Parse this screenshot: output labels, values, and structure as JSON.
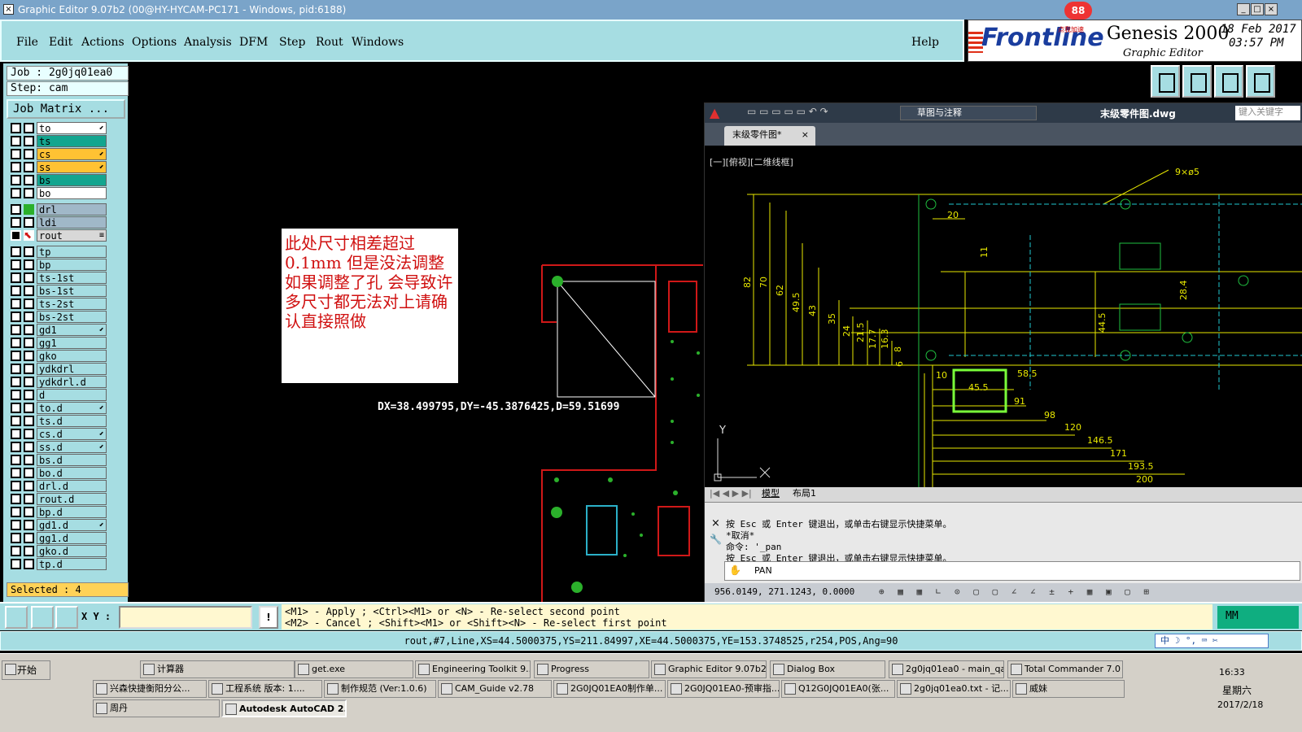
{
  "window": {
    "title": "Graphic Editor 9.07b2 (00@HY-HYCAM-PC171 - Windows, pid:6188)"
  },
  "menu": [
    "File",
    "Edit",
    "Actions",
    "Options",
    "Analysis",
    "DFM",
    "Step",
    "Rout",
    "Windows"
  ],
  "help_label": "Help",
  "brand": {
    "logo": "Frontline",
    "product": "Genesis 2000",
    "subtitle": "Graphic Editor",
    "date": "18 Feb 2017",
    "time": "03:57 PM",
    "badge": "88",
    "badge_sub": "点我加速"
  },
  "job": {
    "job_line": "Job : 2g0jq01ea0",
    "step_line": "Step: cam",
    "matrix_label": "Job Matrix ..."
  },
  "layers": [
    {
      "name": "to",
      "color": "#ffffff",
      "mark": "⬋"
    },
    {
      "name": "ts",
      "color": "#13a58f",
      "mark": ""
    },
    {
      "name": "cs",
      "color": "#ffc233",
      "mark": "⬋"
    },
    {
      "name": "ss",
      "color": "#ffc233",
      "mark": "⬋"
    },
    {
      "name": "bs",
      "color": "#13a58f",
      "mark": ""
    },
    {
      "name": "bo",
      "color": "#ffffff",
      "mark": ""
    },
    {
      "name": "drl",
      "color": "#a0b8c8",
      "mark": ""
    },
    {
      "name": "ldi",
      "color": "#a0b8c8",
      "mark": ""
    },
    {
      "name": "rout",
      "color": "#d8d8d8",
      "mark": "≡"
    },
    {
      "name": "tp",
      "color": "#a6dde2",
      "mark": ""
    },
    {
      "name": "bp",
      "color": "#a6dde2",
      "mark": ""
    },
    {
      "name": "ts-1st",
      "color": "#a6dde2",
      "mark": ""
    },
    {
      "name": "bs-1st",
      "color": "#a6dde2",
      "mark": ""
    },
    {
      "name": "ts-2st",
      "color": "#a6dde2",
      "mark": ""
    },
    {
      "name": "bs-2st",
      "color": "#a6dde2",
      "mark": ""
    },
    {
      "name": "gd1",
      "color": "#a6dde2",
      "mark": "⬋"
    },
    {
      "name": "gg1",
      "color": "#a6dde2",
      "mark": ""
    },
    {
      "name": "gko",
      "color": "#a6dde2",
      "mark": ""
    },
    {
      "name": "ydkdrl",
      "color": "#a6dde2",
      "mark": ""
    },
    {
      "name": "ydkdrl.d",
      "color": "#a6dde2",
      "mark": ""
    },
    {
      "name": "d",
      "color": "#a6dde2",
      "mark": ""
    },
    {
      "name": "to.d",
      "color": "#a6dde2",
      "mark": "⬋"
    },
    {
      "name": "ts.d",
      "color": "#a6dde2",
      "mark": ""
    },
    {
      "name": "cs.d",
      "color": "#a6dde2",
      "mark": "⬋"
    },
    {
      "name": "ss.d",
      "color": "#a6dde2",
      "mark": "⬋"
    },
    {
      "name": "bs.d",
      "color": "#a6dde2",
      "mark": ""
    },
    {
      "name": "bo.d",
      "color": "#a6dde2",
      "mark": ""
    },
    {
      "name": "drl.d",
      "color": "#a6dde2",
      "mark": ""
    },
    {
      "name": "rout.d",
      "color": "#a6dde2",
      "mark": ""
    },
    {
      "name": "bp.d",
      "color": "#a6dde2",
      "mark": ""
    },
    {
      "name": "gd1.d",
      "color": "#a6dde2",
      "mark": "⬋"
    },
    {
      "name": "gg1.d",
      "color": "#a6dde2",
      "mark": ""
    },
    {
      "name": "gko.d",
      "color": "#a6dde2",
      "mark": ""
    },
    {
      "name": "tp.d",
      "color": "#a6dde2",
      "mark": ""
    }
  ],
  "selected": "Selected : 4",
  "graphics": {
    "note": "此处尺寸相差超过0.1mm  但是没法调整  如果调整了孔  会导致许多尺寸都无法对上请确认直接照做",
    "measure": "DX=38.499795,DY=-45.3876425,D=59.51699"
  },
  "acad": {
    "doc_title": "末级零件图.dwg",
    "workspace": "草图与注释",
    "search_placeholder": "键入关键字",
    "tab": "末级零件图*",
    "view_label": "[一][俯视][二维线框]",
    "layout_tabs": [
      "模型",
      "布局1"
    ],
    "cmd_lines": [
      "按 Esc 或 Enter 键退出，或单击右键显示快捷菜单。",
      "*取消*",
      "命令: '_pan",
      "按 Esc 或 Enter 键退出，或单击右键显示快捷菜单。"
    ],
    "cmd_input": "PAN",
    "coords": "956.0149, 271.1243, 0.0000",
    "dims": [
      "9×ø5",
      "20",
      "11",
      "82",
      "70",
      "62",
      "49.5",
      "43",
      "35",
      "24",
      "21.5",
      "17.7",
      "16.3",
      "8",
      "6",
      "44.5",
      "28.4",
      "10",
      "45.5",
      "58.5",
      "91",
      "98",
      "120",
      "146.5",
      "171",
      "193.5",
      "200"
    ]
  },
  "cmd": {
    "xy_label": "X Y :",
    "xy_value": "",
    "hint1": "<M1> - Apply  ; <Ctrl><M1> or <N> - Re-select second point",
    "hint2": "<M2> - Cancel ; <Shift><M1> or <Shift><N> - Re-select first point",
    "unit": "MM"
  },
  "status": "rout,#7,Line,XS=44.5000375,YS=211.84997,XE=44.5000375,YE=153.3748525,r254,POS,Ang=90",
  "ime": "中 ☽ °, ⌨ ✂",
  "taskbar": {
    "start": "开始",
    "items": [
      "计算器",
      "get.exe",
      "Engineering Toolkit 9....",
      "Progress",
      "Graphic Editor 9.07b2 ...",
      "Dialog Box",
      "2g0jq01ea0 - main_qa",
      "Total Commander 7.0 ...",
      "兴森快捷衡阳分公...",
      "工程系统  版本: 1....",
      "制作规范 (Ver:1.0.6)",
      "CAM_Guide v2.78",
      "2G0JQ01EA0制作单...",
      "2G0JQ01EA0-预审指...",
      "Q12G0JQ01EA0(张...",
      "2g0jq01ea0.txt - 记...",
      "威妹",
      "周丹",
      "Autodesk AutoCAD 2..."
    ],
    "clock": "16:33",
    "weekday": "星期六",
    "date": "2017/2/18"
  }
}
